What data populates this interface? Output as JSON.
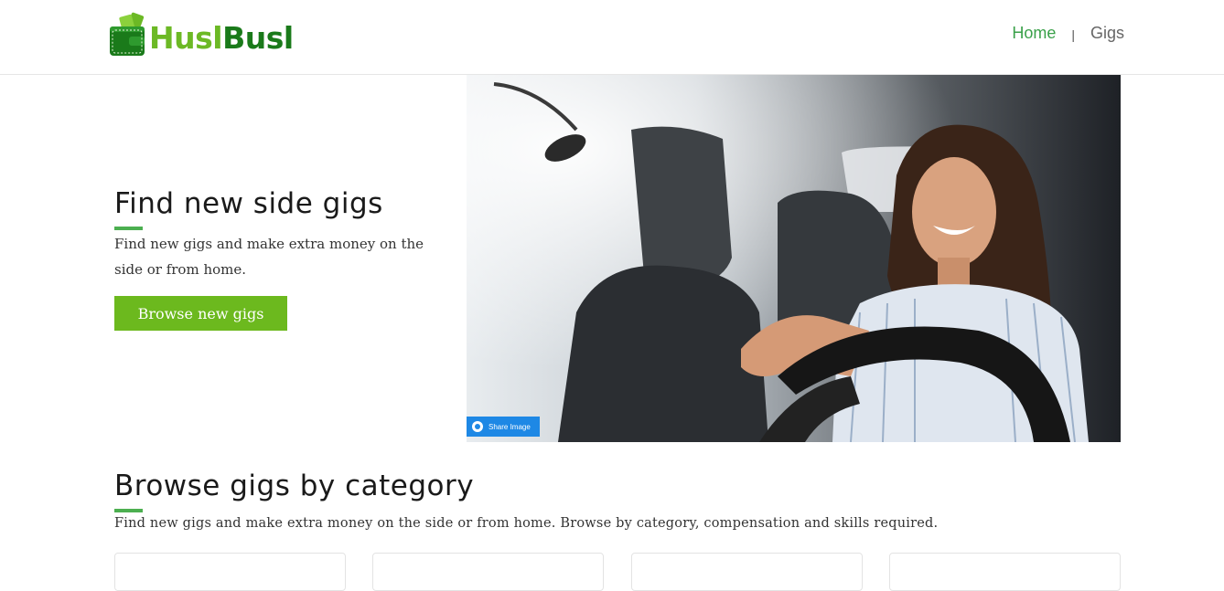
{
  "header": {
    "logo": {
      "text_light": "Husl",
      "text_dark": "Busl"
    },
    "nav": {
      "home": "Home",
      "separator": "|",
      "gigs": "Gigs"
    }
  },
  "hero": {
    "title": "Find new side gigs",
    "subtitle": "Find new gigs and make extra money on the side or from home.",
    "button_label": "Browse new gigs",
    "image_share_label": "Share Image"
  },
  "categories": {
    "title": "Browse gigs by category",
    "subtitle": "Find new gigs and make extra money on the side or from home.  Browse by category, compensation and skills required.",
    "card_count": 4
  },
  "colors": {
    "accent_green": "#6cb91e",
    "logo_dark_green": "#1a7a1a",
    "nav_active": "#3aa14a",
    "underline": "#4caf50",
    "share_blue": "#1e88e5"
  }
}
